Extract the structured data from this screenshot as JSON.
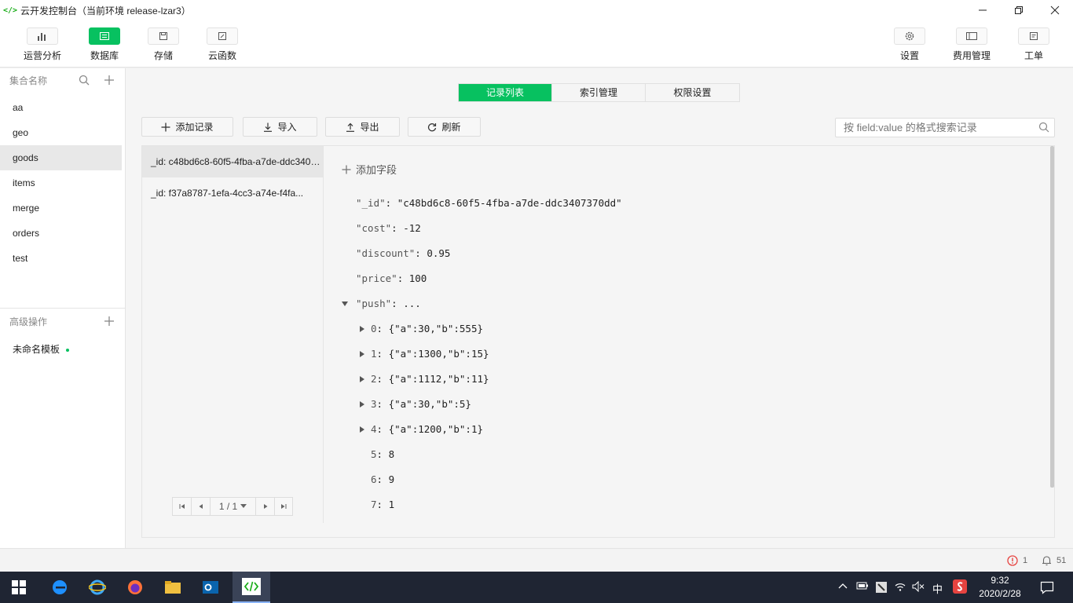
{
  "window": {
    "title": "云开发控制台（当前环境 release-lzar3）"
  },
  "toolbar": {
    "left": [
      {
        "label": "运营分析",
        "icon": "bar-chart-icon"
      },
      {
        "label": "数据库",
        "icon": "database-icon",
        "active": true
      },
      {
        "label": "存储",
        "icon": "storage-icon"
      },
      {
        "label": "云函数",
        "icon": "function-icon"
      }
    ],
    "right": [
      {
        "label": "设置",
        "icon": "gear-icon"
      },
      {
        "label": "费用管理",
        "icon": "billing-icon"
      },
      {
        "label": "工单",
        "icon": "ticket-icon"
      }
    ]
  },
  "sidebar": {
    "collections_header": "集合名称",
    "collections": [
      "aa",
      "geo",
      "goods",
      "items",
      "merge",
      "orders",
      "test"
    ],
    "selected_collection": "goods",
    "advanced_header": "高级操作",
    "templates": [
      "未命名模板"
    ]
  },
  "tabs": [
    "记录列表",
    "索引管理",
    "权限设置"
  ],
  "actions": {
    "add": "添加记录",
    "import": "导入",
    "export": "导出",
    "refresh": "刷新"
  },
  "search": {
    "placeholder": "按 field:value 的格式搜索记录"
  },
  "records": [
    "_id: c48bd6c8-60f5-4fba-a7de-ddc3407370dd",
    "_id: f37a8787-1efa-4cc3-a74e-f4fa..."
  ],
  "pager": {
    "page": "1 / 1"
  },
  "detail": {
    "add_field": "添加字段",
    "fields": [
      {
        "key": "\"_id\"",
        "value": "\"c48bd6c8-60f5-4fba-a7de-ddc3407370dd\""
      },
      {
        "key": "\"cost\"",
        "value": "-12"
      },
      {
        "key": "\"discount\"",
        "value": "0.95"
      },
      {
        "key": "\"price\"",
        "value": "100"
      },
      {
        "key": "\"push\"",
        "value": "..."
      }
    ],
    "push_items": [
      {
        "key": "0",
        "value": "{\"a\":30,\"b\":555}"
      },
      {
        "key": "1",
        "value": "{\"a\":1300,\"b\":15}"
      },
      {
        "key": "2",
        "value": "{\"a\":1112,\"b\":11}"
      },
      {
        "key": "3",
        "value": "{\"a\":30,\"b\":5}"
      },
      {
        "key": "4",
        "value": "{\"a\":1200,\"b\":1}"
      },
      {
        "key": "5",
        "value": "8"
      },
      {
        "key": "6",
        "value": "9"
      },
      {
        "key": "7",
        "value": "1"
      }
    ]
  },
  "statusbar": {
    "errors": "1",
    "notifications": "51"
  },
  "taskbar": {
    "time": "9:32",
    "date": "2020/2/28",
    "ime": "中"
  },
  "colors": {
    "accent": "#07c160",
    "error": "#e64340",
    "taskbar": "#1f2533"
  }
}
